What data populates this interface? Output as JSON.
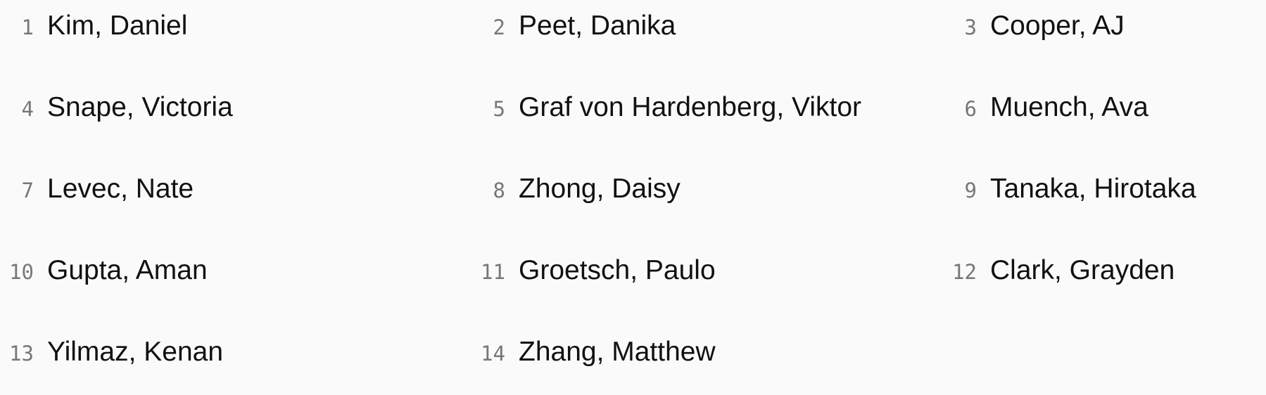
{
  "roster": {
    "entries": [
      {
        "number": "1",
        "name": "Kim, Daniel"
      },
      {
        "number": "2",
        "name": "Peet, Danika"
      },
      {
        "number": "3",
        "name": "Cooper, AJ"
      },
      {
        "number": "4",
        "name": "Snape, Victoria"
      },
      {
        "number": "5",
        "name": "Graf von Hardenberg, Viktor"
      },
      {
        "number": "6",
        "name": "Muench, Ava"
      },
      {
        "number": "7",
        "name": "Levec, Nate"
      },
      {
        "number": "8",
        "name": "Zhong, Daisy"
      },
      {
        "number": "9",
        "name": "Tanaka, Hirotaka"
      },
      {
        "number": "10",
        "name": "Gupta, Aman"
      },
      {
        "number": "11",
        "name": "Groetsch, Paulo"
      },
      {
        "number": "12",
        "name": "Clark, Grayden"
      },
      {
        "number": "13",
        "name": "Yilmaz, Kenan"
      },
      {
        "number": "14",
        "name": "Zhang, Matthew"
      }
    ]
  }
}
